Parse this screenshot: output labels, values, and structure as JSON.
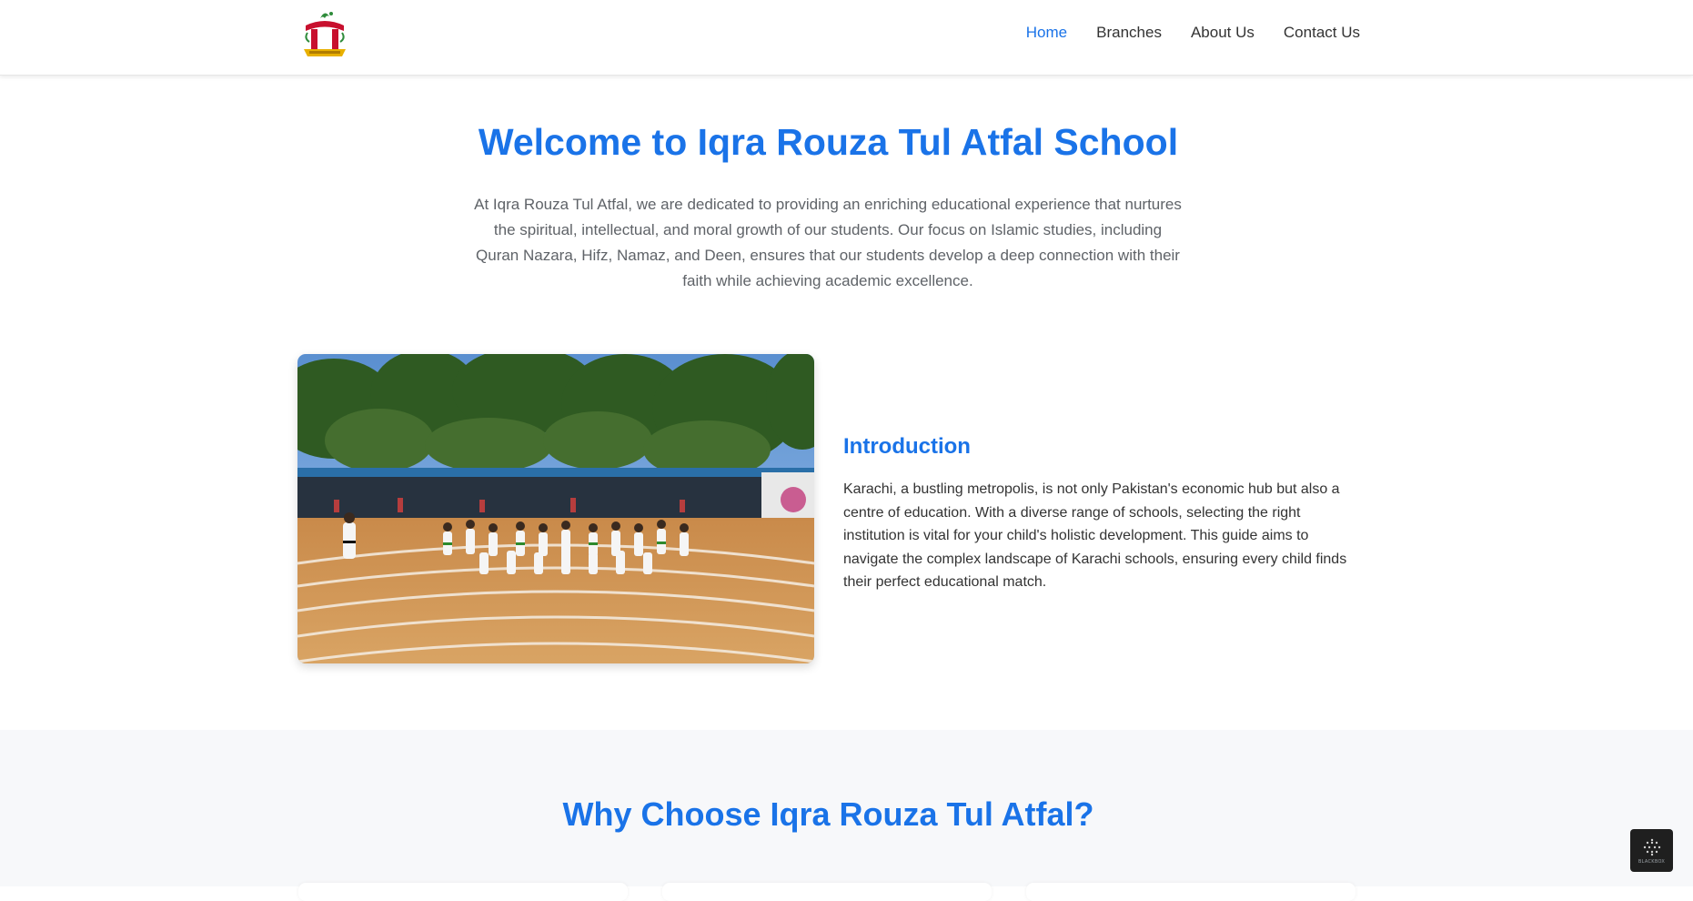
{
  "header": {
    "nav": [
      {
        "label": "Home",
        "active": true
      },
      {
        "label": "Branches",
        "active": false
      },
      {
        "label": "About Us",
        "active": false
      },
      {
        "label": "Contact Us",
        "active": false
      }
    ]
  },
  "hero": {
    "title": "Welcome to Iqra Rouza Tul Atfal School",
    "text": "At Iqra Rouza Tul Atfal, we are dedicated to providing an enriching educational experience that nurtures the spiritual, intellectual, and moral growth of our students. Our focus on Islamic studies, including Quran Nazara, Hifz, Namaz, and Deen, ensures that our students develop a deep connection with their faith while achieving academic excellence."
  },
  "intro": {
    "title": "Introduction",
    "text": "Karachi, a bustling metropolis, is not only Pakistan's economic hub but also a centre of education. With a diverse range of schools, selecting the right institution is vital for your child's holistic development. This guide aims to navigate the complex landscape of Karachi schools, ensuring every child finds their perfect educational match."
  },
  "why": {
    "title": "Why Choose Iqra Rouza Tul Atfal?"
  },
  "widget": {
    "label": "BLACKBOX"
  },
  "colors": {
    "accent": "#1a73e8",
    "text": "#333333",
    "muted": "#5f6368",
    "section_bg": "#f7f8fa"
  }
}
